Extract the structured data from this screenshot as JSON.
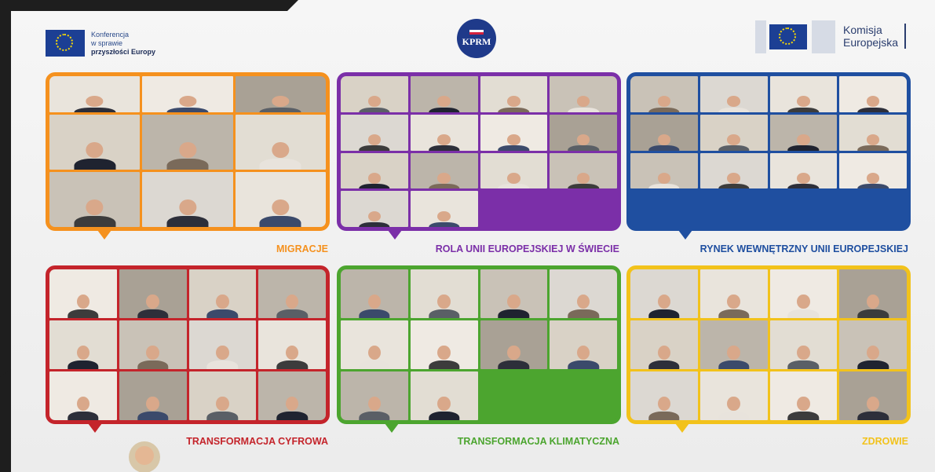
{
  "header": {
    "conference_line1": "Konferencja",
    "conference_line2": "w sprawie",
    "conference_line3": "przyszłości Europy",
    "center_logo_text": "KPRM",
    "commission_line1": "Komisja",
    "commission_line2": "Europejska"
  },
  "colors": {
    "orange": "#f5911e",
    "purple": "#7b2fa8",
    "blue": "#1f4fa0",
    "red": "#c4242b",
    "green": "#4ca52f",
    "yellow": "#f2c21b"
  },
  "panels": [
    {
      "label": "MIGRACJE"
    },
    {
      "label": "ROLA UNII EUROPEJSKIEJ W ŚWIECIE"
    },
    {
      "label": "RYNEK WEWNĘTRZNY UNII EUROPEJSKIEJ"
    },
    {
      "label": "TRANSFORMACJA CYFROWA"
    },
    {
      "label": "TRANSFORMACJA KLIMATYCZNA"
    },
    {
      "label": "ZDROWIE"
    }
  ]
}
